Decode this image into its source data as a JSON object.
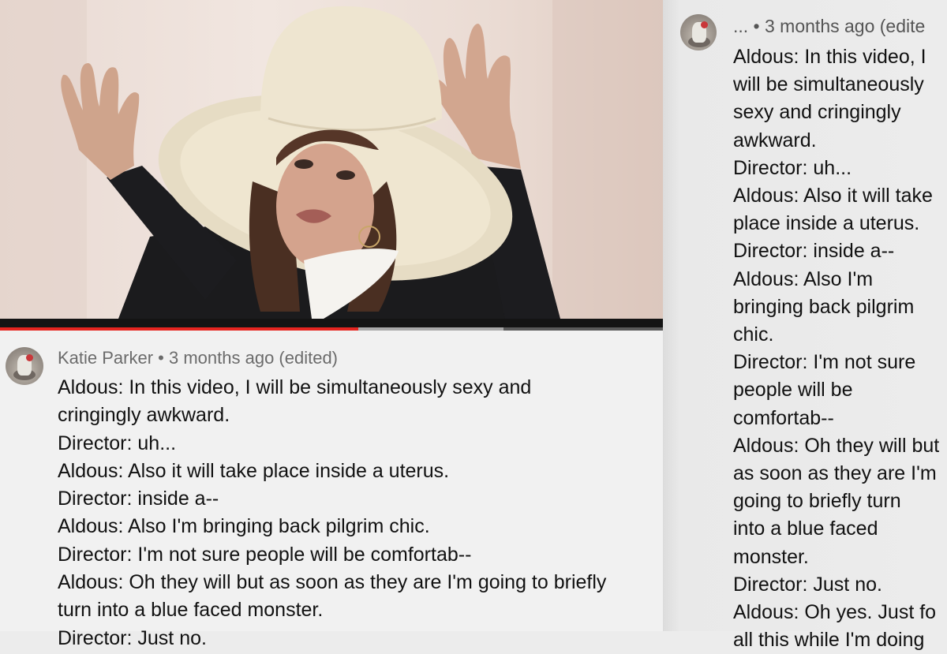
{
  "video": {
    "progress_fraction": 0.54,
    "buffered_fraction": 0.76
  },
  "left_comment": {
    "author": "Katie Parker",
    "meta": " • 3 months ago (edited)",
    "lines": [
      "Aldous: In this video, I will be simultaneously sexy and",
      "cringingly awkward.",
      "Director: uh...",
      "Aldous: Also it will take place inside a uterus.",
      "Director: inside a--",
      "Aldous: Also I'm bringing back pilgrim chic.",
      "Director: I'm not sure people will be comfortab--",
      "Aldous: Oh they will but as soon as they are I'm going to briefly",
      "turn into a blue faced monster.",
      "Director: Just no."
    ]
  },
  "right_comment": {
    "author": "...",
    "meta": " • 3 months ago (edite",
    "lines": [
      "Aldous: In this video, I",
      "will be simultaneously",
      "sexy and cringingly",
      "awkward.",
      "Director: uh...",
      "Aldous: Also it will take",
      "place inside a uterus.",
      "Director: inside a--",
      "Aldous: Also I'm",
      "bringing back pilgrim",
      "chic.",
      "Director: I'm not sure",
      "people will be",
      "comfortab--",
      "Aldous: Oh they will but",
      "as soon as they are I'm",
      "going to briefly turn",
      "into a blue faced",
      "monster.",
      "Director: Just no.",
      "Aldous: Oh yes. Just fo",
      "all this while I'm doing"
    ]
  },
  "colors": {
    "progress_played": "#e52520",
    "progress_buffer": "#a9a9a9",
    "comment_bg": "#f1f1f1",
    "meta_text": "#6b6b6b"
  }
}
